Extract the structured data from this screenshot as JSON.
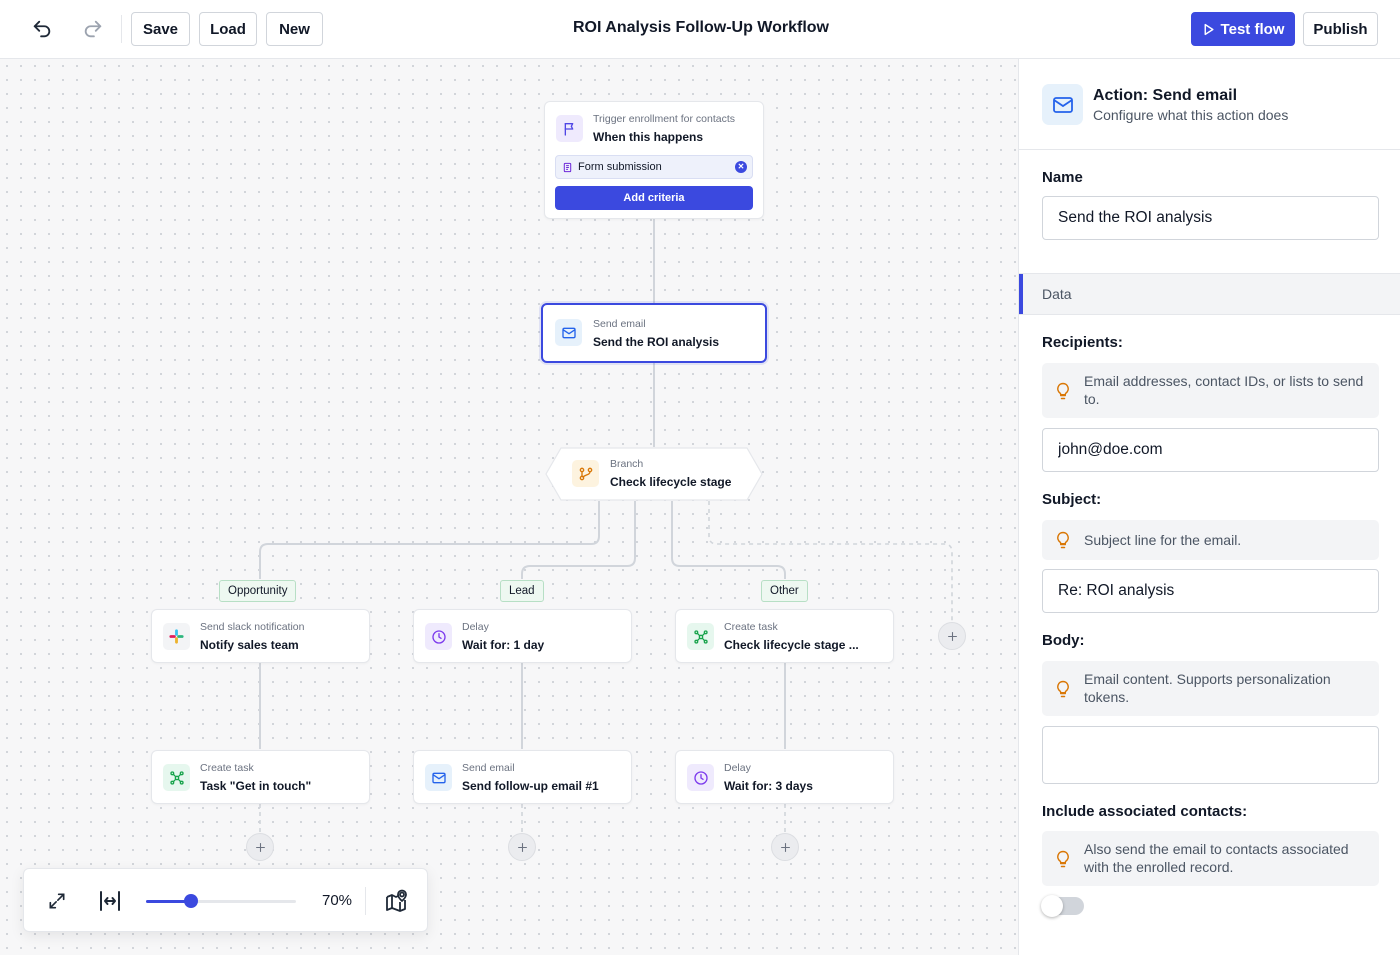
{
  "toolbar": {
    "undo_icon": "undo-icon",
    "redo_icon": "redo-icon",
    "save_label": "Save",
    "load_label": "Load",
    "new_label": "New",
    "title": "ROI Analysis Follow-Up Workflow",
    "test_flow_label": "Test flow",
    "publish_label": "Publish",
    "accent_color": "#3b49df"
  },
  "canvas": {
    "trigger": {
      "subtitle": "Trigger enrollment for contacts",
      "title": "When this happens",
      "criteria": "Form submission",
      "add_criteria_label": "Add criteria",
      "icon": "flag-icon"
    },
    "send_email": {
      "subtitle": "Send email",
      "title": "Send the ROI analysis",
      "icon": "mail-icon"
    },
    "branch": {
      "subtitle": "Branch",
      "title": "Check lifecycle stage",
      "icon": "branch-icon"
    },
    "branches": [
      {
        "tag": "Opportunity",
        "first": {
          "subtitle": "Send slack notification",
          "title": "Notify sales team",
          "icon": "slack-icon"
        },
        "second": {
          "subtitle": "Create task",
          "title": "Task \"Get in touch\"",
          "icon": "task-icon"
        }
      },
      {
        "tag": "Lead",
        "first": {
          "subtitle": "Delay",
          "title": "Wait for: 1 day",
          "icon": "clock-icon"
        },
        "second": {
          "subtitle": "Send email",
          "title": "Send follow-up email #1",
          "icon": "mail-icon"
        }
      },
      {
        "tag": "Other",
        "first": {
          "subtitle": "Create task",
          "title": "Check lifecycle stage ...",
          "icon": "task-icon"
        },
        "second": {
          "subtitle": "Delay",
          "title": "Wait for: 3 days",
          "icon": "clock-icon"
        }
      }
    ],
    "zoom": {
      "value_label": "70%",
      "level": 0.3
    }
  },
  "panel": {
    "title": "Action: Send email",
    "subtitle": "Configure what this action does",
    "name_label": "Name",
    "name_value": "Send the ROI analysis",
    "section_label": "Data",
    "recipients_label": "Recipients:",
    "recipients_hint": "Email addresses, contact IDs, or lists to send to.",
    "recipients_value": "john@doe.com",
    "subject_label": "Subject:",
    "subject_hint": "Subject line for the email.",
    "subject_value": "Re: ROI analysis",
    "body_label": "Body:",
    "body_hint": "Email content. Supports personalization tokens.",
    "body_value": "",
    "associated_label": "Include associated contacts:",
    "associated_hint": "Also send the email to contacts associated with the enrolled record.",
    "associated_enabled": false
  }
}
